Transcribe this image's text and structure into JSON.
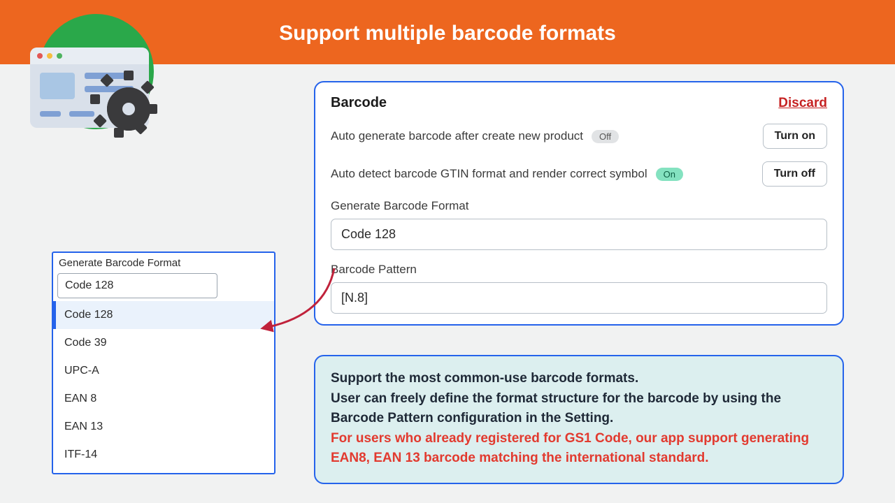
{
  "header": {
    "title": "Support multiple barcode formats"
  },
  "settings": {
    "section_title": "Barcode",
    "discard": "Discard",
    "row1": {
      "label": "Auto generate barcode after create new product",
      "badge": "Off",
      "button": "Turn on"
    },
    "row2": {
      "label": "Auto detect barcode GTIN format and render correct symbol",
      "badge": "On",
      "button": "Turn off"
    },
    "format": {
      "label": "Generate Barcode Format",
      "value": "Code 128"
    },
    "pattern": {
      "label": "Barcode Pattern",
      "value": "[N.8]"
    }
  },
  "dropdown": {
    "label": "Generate Barcode Format",
    "input_value": "Code 128",
    "options": [
      "Code 128",
      "Code 39",
      "UPC-A",
      "EAN 8",
      "EAN 13",
      "ITF-14"
    ]
  },
  "note": {
    "p1": "Support the most common-use barcode formats.",
    "p2": "User can freely define the format structure for the barcode by using the Barcode Pattern configuration in the Setting.",
    "p3": "For users who already registered for GS1 Code, our app support generating EAN8, EAN 13 barcode matching the international standard."
  }
}
